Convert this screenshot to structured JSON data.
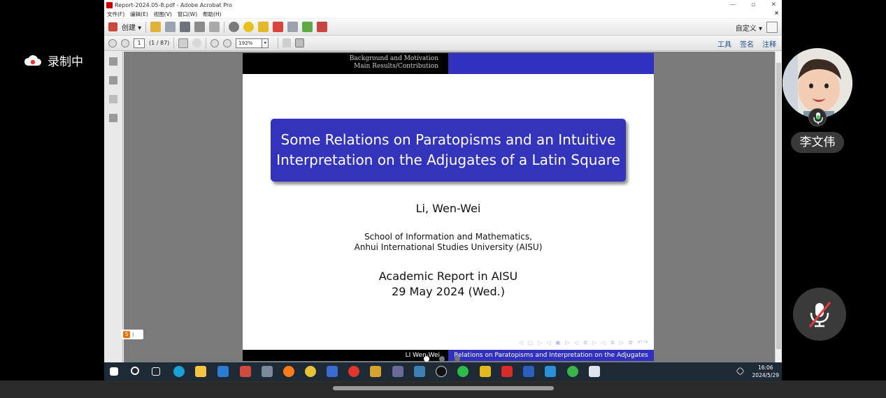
{
  "recording": {
    "label": "录制中"
  },
  "window": {
    "title": "Report-2024.05-8.pdf - Adobe Acrobat Pro",
    "menu": [
      "文件(F)",
      "编辑(E)",
      "视图(V)",
      "窗口(W)",
      "帮助(H)"
    ],
    "create_label": "创建",
    "custom_label": "自定义",
    "page_number": "1",
    "page_count": "(1 / 87)",
    "zoom": "192%",
    "right_tools": [
      "工具",
      "签名",
      "注释"
    ]
  },
  "slide": {
    "header_line1": "Background and Motivation",
    "header_line2": "Main Results/Contribution",
    "title_line1": "Some Relations on Paratopisms and an Intuitive",
    "title_line2": "Interpretation on the Adjugates of a Latin Square",
    "author": "Li, Wen-Wei",
    "affiliation_line1": "School of Information and Mathematics,",
    "affiliation_line2": "Anhui International Studies University (AISU)",
    "event_line1": "Academic Report in AISU",
    "event_line2": "29 May 2024 (Wed.)",
    "footer_left": "LI Wen-Wei",
    "footer_right": "Relations on Paratopisms and Interpretation on the Adjugates"
  },
  "taskbar": {
    "time": "16:06",
    "date": "2024/5/29"
  },
  "participant": {
    "name": "李文伟"
  },
  "colors": {
    "beamer_blue": "#3333bb",
    "taskbar": "#1f2a37"
  }
}
